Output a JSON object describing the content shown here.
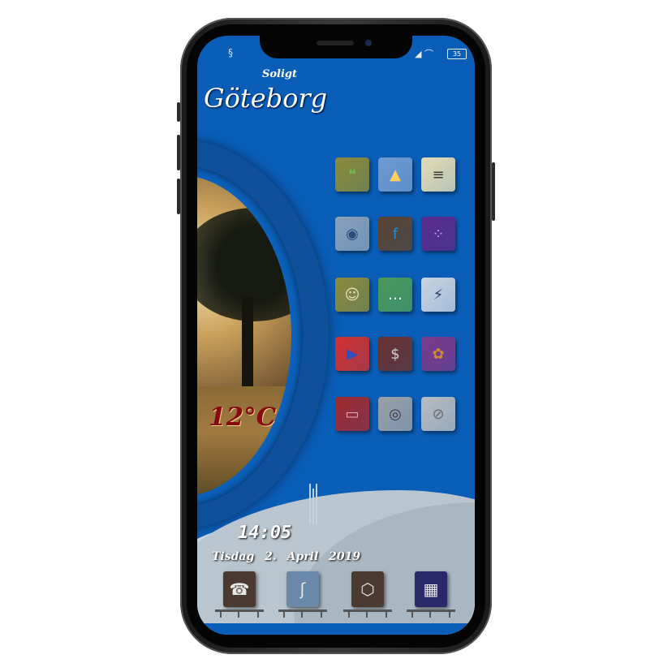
{
  "status_bar": {
    "left_icon": "swirl-icon",
    "battery": "35"
  },
  "weather": {
    "condition": "Soligt",
    "city": "Göteborg",
    "temperature": "12°C"
  },
  "clock": {
    "time": "14:05",
    "date_day": "Tisdag 2.",
    "date_month_year": "April 2019"
  },
  "apps": [
    {
      "name": "messages-app",
      "icon": "chat-bubbles-icon",
      "bg": "#8a8a3a",
      "fg": "#6ac04a"
    },
    {
      "name": "photos-app",
      "icon": "mountain-sun-icon",
      "bg": "#6f9ad0",
      "fg": "#ffd060"
    },
    {
      "name": "notes-app",
      "icon": "notepad-icon",
      "bg": "#e3dcb4",
      "fg": "#3a3a3a"
    },
    {
      "name": "camera-app",
      "icon": "camera-lens-icon",
      "bg": "#8aa0b8",
      "fg": "#2a4a7a"
    },
    {
      "name": "facebook-app",
      "icon": "facebook-book-icon",
      "bg": "#5a4330",
      "fg": "#2a8ad0"
    },
    {
      "name": "game-app",
      "icon": "purple-dots-icon",
      "bg": "#5b2a8a",
      "fg": "#d0a0ff"
    },
    {
      "name": "snapchat-app",
      "icon": "ghost-icon",
      "bg": "#8a8a3a",
      "fg": "#f0e0c0"
    },
    {
      "name": "chat-app",
      "icon": "speech-bubble-icon",
      "bg": "#4a9a5a",
      "fg": "#ffffff"
    },
    {
      "name": "weather-app",
      "icon": "lightning-icon",
      "bg": "#c8d4e0",
      "fg": "#2a3a6a"
    },
    {
      "name": "music-app",
      "icon": "play-triangle-icon",
      "bg": "#d03030",
      "fg": "#3050c0"
    },
    {
      "name": "bank-app",
      "icon": "bank-building-icon",
      "bg": "#6a3030",
      "fg": "#d0d0d0"
    },
    {
      "name": "flower-app",
      "icon": "flower-icon",
      "bg": "#7a3a8a",
      "fg": "#d08a30"
    },
    {
      "name": "folder-app",
      "icon": "red-folder-icon",
      "bg": "#a02a30",
      "fg": "#e0b0b0"
    },
    {
      "name": "instagram-app",
      "icon": "rainbow-camera-icon",
      "bg": "#9aa0a8",
      "fg": "#3a3a3a"
    },
    {
      "name": "settings-app",
      "icon": "toggle-switch-icon",
      "bg": "#b8bcc0",
      "fg": "#6a6a6a"
    }
  ],
  "dock": [
    {
      "name": "phone-app",
      "icon": "telephone-keypad-icon",
      "bg": "#4a3a30"
    },
    {
      "name": "browser-app",
      "icon": "swoosh-icon",
      "bg": "#6a88a8"
    },
    {
      "name": "photos-dock-app",
      "icon": "hexagon-icon",
      "bg": "#4a3a30"
    },
    {
      "name": "music-dock-app",
      "icon": "gradient-tile-icon",
      "bg": "#2a2a6a"
    }
  ]
}
